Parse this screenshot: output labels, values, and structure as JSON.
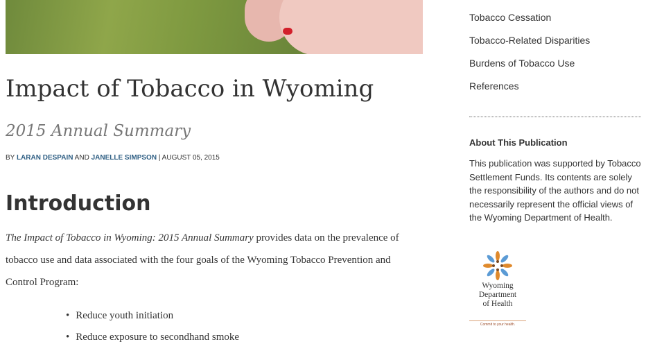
{
  "article": {
    "title": "Impact of Tobacco in Wyoming",
    "subtitle": "2015 Annual Summary",
    "byline": {
      "prefix": "BY",
      "author1": "LARAN DESPAIN",
      "and": "AND",
      "author2": "JANELLE SIMPSON",
      "separator": "|",
      "date": "AUGUST 05, 2015"
    },
    "intro_heading": "Introduction",
    "intro_italic": "The Impact of Tobacco in Wyoming: 2015 Annual Summary",
    "intro_text": " provides data on the prevalence of tobacco use and data associated with the four goals of the Wyoming Tobacco Prevention and Control Program:",
    "goals": [
      "Reduce youth initiation",
      "Reduce exposure to secondhand smoke"
    ]
  },
  "sidebar": {
    "links": [
      "Tobacco Cessation",
      "Tobacco-Related Disparities",
      "Burdens of Tobacco Use",
      "References"
    ],
    "about_heading": "About This Publication",
    "about_text": "This publication was supported by Tobacco Settlement Funds. Its contents are solely the responsibility of the authors and do not necessarily represent the official views of the Wyoming Department of Health.",
    "logo": {
      "line1": "Wyoming",
      "line2": "Department",
      "line3": "of Health",
      "tagline": "Commit to your health."
    }
  },
  "colors": {
    "link": "#2f5f84",
    "accent_orange": "#e08a2c",
    "accent_blue": "#5b9bd5"
  }
}
